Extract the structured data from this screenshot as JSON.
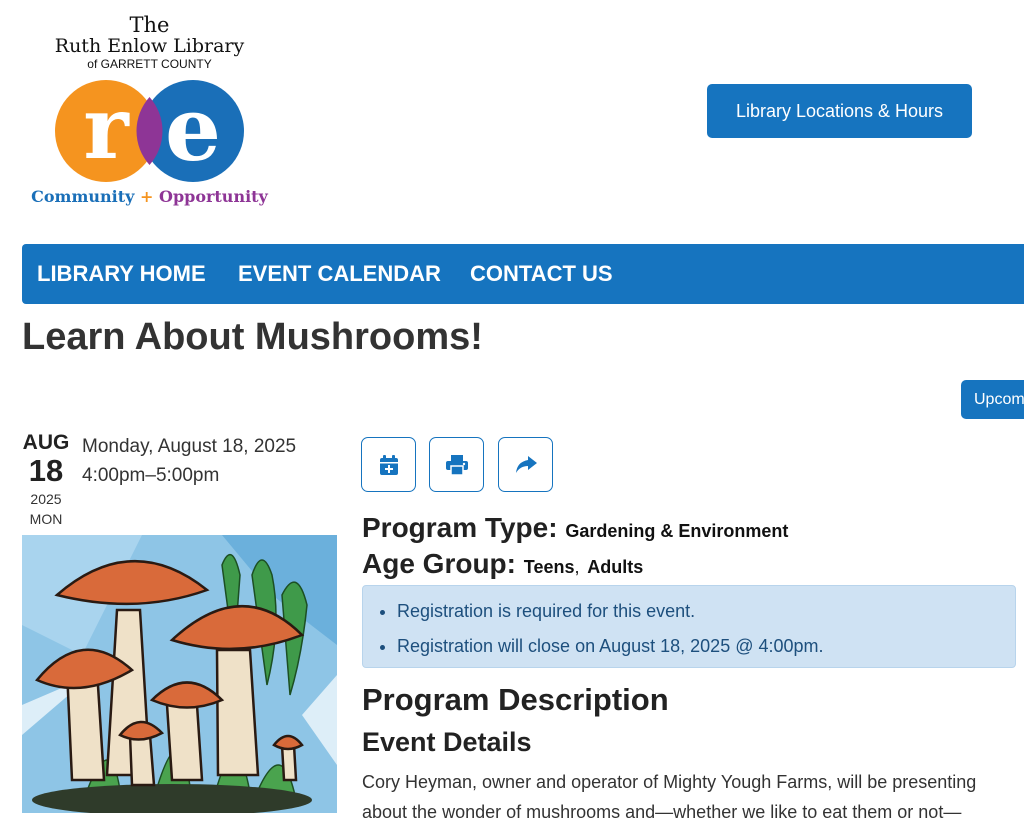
{
  "logo": {
    "line1": "The",
    "line2": "Ruth Enlow Library",
    "line3": "of GARRETT COUNTY",
    "mark_letters": "re",
    "tagline_community": "Community",
    "tagline_plus": "+",
    "tagline_opportunity": "Opportunity"
  },
  "header": {
    "locations_button": "Library Locations & Hours"
  },
  "nav": {
    "items": [
      "LIBRARY HOME",
      "EVENT CALENDAR",
      "CONTACT US"
    ]
  },
  "page": {
    "title": "Learn About Mushrooms!",
    "upcoming_button": "Upcoming Events"
  },
  "event": {
    "month": "AUG",
    "day": "18",
    "year": "2025",
    "weekday": "MON",
    "date_full": "Monday, August 18, 2025",
    "time": "4:00pm–5:00pm",
    "actions": [
      {
        "icon": "calendar-plus-icon",
        "label": "Add to calendar"
      },
      {
        "icon": "print-icon",
        "label": "Print"
      },
      {
        "icon": "share-icon",
        "label": "Share"
      }
    ],
    "program_type_label": "Program Type:",
    "program_type_value": "Gardening & Environment",
    "age_group_label": "Age Group:",
    "age_group_teens": "Teens",
    "age_group_sep": ",",
    "age_group_adults": "Adults",
    "registration_notes": [
      "Registration is required for this event.",
      "Registration will close on August 18, 2025 @ 4:00pm."
    ],
    "description_heading": "Program Description",
    "details_heading": "Event Details",
    "description_text": "Cory Heyman, owner and operator of Mighty Yough Farms, will be presenting about the wonder of mushrooms and—whether we like to eat them or not—"
  },
  "colors": {
    "primary": "#1674bf",
    "logo_orange": "#f5941f",
    "logo_blue": "#1a6fb8",
    "logo_purple": "#8e3596",
    "notice_bg": "#cfe2f3"
  }
}
